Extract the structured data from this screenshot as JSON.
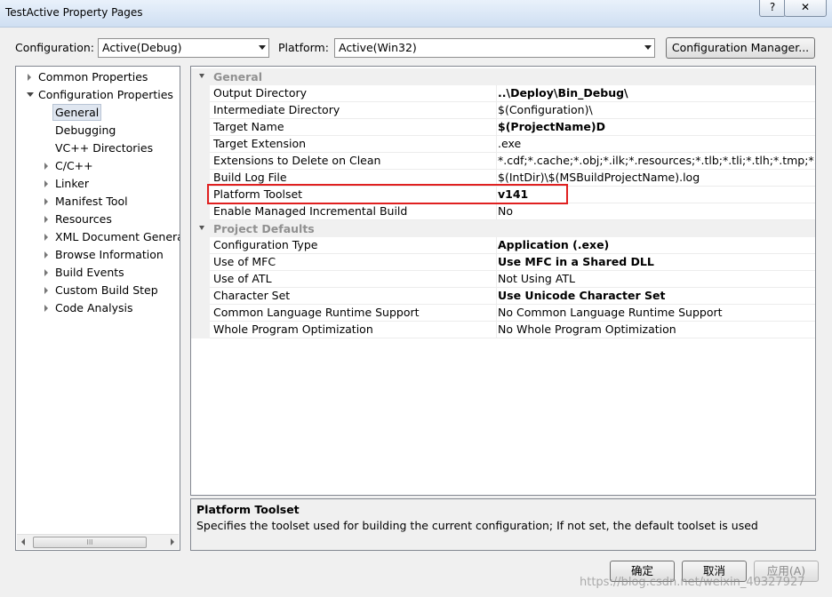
{
  "window": {
    "title": "TestActive Property Pages",
    "help": "?",
    "close": "✕"
  },
  "toolbar": {
    "configuration_label": "Configuration:",
    "configuration_value": "Active(Debug)",
    "platform_label": "Platform:",
    "platform_value": "Active(Win32)",
    "config_manager_label": "Configuration Manager..."
  },
  "tree": {
    "items": [
      {
        "label": "Common Properties",
        "expanded": false
      },
      {
        "label": "Configuration Properties",
        "expanded": true
      },
      {
        "label": "General",
        "selected": true
      },
      {
        "label": "Debugging"
      },
      {
        "label": "VC++ Directories"
      },
      {
        "label": "C/C++",
        "expandable": true
      },
      {
        "label": "Linker",
        "expandable": true
      },
      {
        "label": "Manifest Tool",
        "expandable": true
      },
      {
        "label": "Resources",
        "expandable": true
      },
      {
        "label": "XML Document Generat",
        "expandable": true
      },
      {
        "label": "Browse Information",
        "expandable": true
      },
      {
        "label": "Build Events",
        "expandable": true
      },
      {
        "label": "Custom Build Step",
        "expandable": true
      },
      {
        "label": "Code Analysis",
        "expandable": true
      }
    ],
    "scroll_thumb": "III"
  },
  "grid": {
    "categories": [
      {
        "title": "General",
        "rows": [
          {
            "name": "Output Directory",
            "value": "..\\Deploy\\Bin_Debug\\",
            "bold": true
          },
          {
            "name": "Intermediate Directory",
            "value": "$(Configuration)\\",
            "bold": false
          },
          {
            "name": "Target Name",
            "value": "$(ProjectName)D",
            "bold": true
          },
          {
            "name": "Target Extension",
            "value": ".exe",
            "bold": false
          },
          {
            "name": "Extensions to Delete on Clean",
            "value": "*.cdf;*.cache;*.obj;*.ilk;*.resources;*.tlb;*.tli;*.tlh;*.tmp;*.rsp;*.pgc",
            "bold": false
          },
          {
            "name": "Build Log File",
            "value": "$(IntDir)\\$(MSBuildProjectName).log",
            "bold": false
          },
          {
            "name": "Platform Toolset",
            "value": "v141",
            "bold": true
          },
          {
            "name": "Enable Managed Incremental Build",
            "value": "No",
            "bold": false
          }
        ]
      },
      {
        "title": "Project Defaults",
        "rows": [
          {
            "name": "Configuration Type",
            "value": "Application (.exe)",
            "bold": true
          },
          {
            "name": "Use of MFC",
            "value": "Use MFC in a Shared DLL",
            "bold": true
          },
          {
            "name": "Use of ATL",
            "value": "Not Using ATL",
            "bold": false
          },
          {
            "name": "Character Set",
            "value": "Use Unicode Character Set",
            "bold": true
          },
          {
            "name": "Common Language Runtime Support",
            "value": "No Common Language Runtime Support",
            "bold": false
          },
          {
            "name": "Whole Program Optimization",
            "value": "No Whole Program Optimization",
            "bold": false
          }
        ]
      }
    ]
  },
  "description": {
    "title": "Platform Toolset",
    "text": "Specifies the toolset used for building the current configuration; If not set, the default toolset is used"
  },
  "buttons": {
    "ok": "确定",
    "cancel": "取消",
    "apply": "应用(A)"
  },
  "watermark": "https://blog.csdn.net/weixin_40327927"
}
